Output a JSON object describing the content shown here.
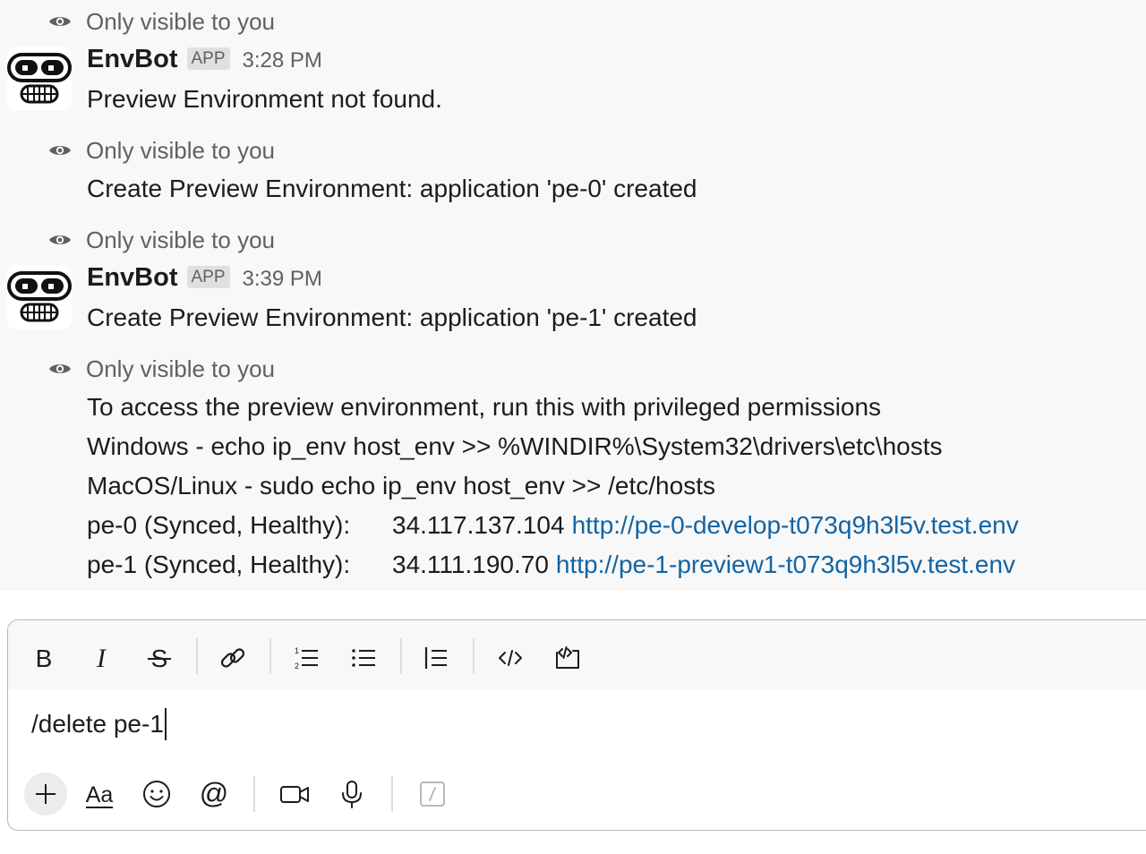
{
  "messages": [
    {
      "type": "ephemeral_notice",
      "text": "Only visible to you"
    },
    {
      "type": "message",
      "sender": "EnvBot",
      "badge": "APP",
      "time": "3:28 PM",
      "text": "Preview Environment not found."
    },
    {
      "type": "ephemeral_notice",
      "text": "Only visible to you"
    },
    {
      "type": "message_continuation",
      "text": "Create Preview Environment: application 'pe-0' created"
    },
    {
      "type": "ephemeral_notice",
      "text": "Only visible to you"
    },
    {
      "type": "message",
      "sender": "EnvBot",
      "badge": "APP",
      "time": "3:39 PM",
      "text": "Create Preview Environment: application 'pe-1' created"
    },
    {
      "type": "ephemeral_notice",
      "text": "Only visible to you"
    },
    {
      "type": "message_continuation",
      "lines": [
        "To access the preview environment, run this with privileged permissions",
        "Windows - echo ip_env host_env >> %WINDIR%\\System32\\drivers\\etc\\hosts",
        "MacOS/Linux - sudo echo ip_env host_env >> /etc/hosts"
      ],
      "environments": [
        {
          "name": "pe-0 (Synced, Healthy):",
          "ip": "34.117.137.104",
          "url": "http://pe-0-develop-t073q9h3l5v.test.env"
        },
        {
          "name": "pe-1 (Synced, Healthy):",
          "ip": "34.111.190.70",
          "url": "http://pe-1-preview1-t073q9h3l5v.test.env"
        }
      ]
    }
  ],
  "composer": {
    "input_value": "/delete pe-1",
    "format_toolbar": [
      "bold-icon",
      "italic-icon",
      "strikethrough-icon",
      "link-icon",
      "ordered-list-icon",
      "bulleted-list-icon",
      "blockquote-icon",
      "code-icon",
      "code-block-icon"
    ],
    "bottom_toolbar": [
      "plus-icon",
      "formatting-icon",
      "emoji-icon",
      "mention-icon",
      "video-icon",
      "microphone-icon",
      "shortcuts-icon"
    ],
    "formatting_glyph": "Aa"
  },
  "colors": {
    "link": "#1264a3",
    "muted_text": "#616061",
    "message_bg": "#f8f8f8",
    "primary_text": "#1d1c1d"
  }
}
